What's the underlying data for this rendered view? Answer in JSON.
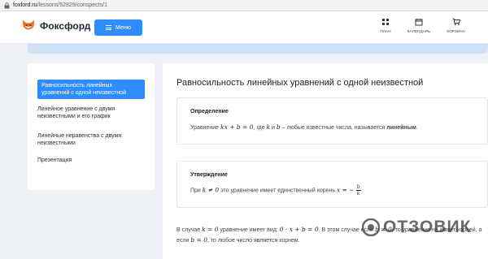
{
  "browser": {
    "url_domain": "foxford.ru",
    "url_path": "/lessons/52829/conspects/1"
  },
  "header": {
    "brand": "Фоксфорд",
    "menu_label": "Меню",
    "nav": [
      {
        "label": "ПЛАН",
        "icon": "plan-icon"
      },
      {
        "label": "КАЛЕНДАРЬ",
        "icon": "calendar-icon"
      },
      {
        "label": "КОРЗИНА",
        "icon": "cart-icon"
      }
    ]
  },
  "colors": {
    "accent": "#2f8cff",
    "banner": "#cfe1f7",
    "background": "#eef1f6"
  },
  "sidebar": {
    "items": [
      {
        "label": "Равносильность линейных уравнений с одной неизвестной",
        "active": true
      },
      {
        "label": "Линейное уравнение с двумя неизвестными и его график",
        "active": false
      },
      {
        "label": "Линейные неравенства с двумя неизвестными",
        "active": false
      },
      {
        "label": "Презентация",
        "active": false
      }
    ]
  },
  "main": {
    "title": "Равносильность линейных уравнений с одной неизвестной",
    "definition": {
      "title": "Определение",
      "text_prefix": "Уравнение",
      "formula": "kx + b = 0",
      "text_mid1": ", где",
      "var_k": "k",
      "text_and": "и",
      "var_b": "b",
      "text_mid2": "– любые известные числа, называется",
      "term": "линейным",
      "text_end": "."
    },
    "statement": {
      "title": "Утверждение",
      "text_prefix": "При",
      "condition": "k ≠ 0",
      "text_mid": "это уравнение имеет единственный корень",
      "root_lhs": "x = −",
      "root_num": "b",
      "root_den": "k"
    },
    "paragraph": {
      "s1": "В случае",
      "m1": "k = 0",
      "s2": "уравнение имеет вид:",
      "m2": "0 · x + b = 0",
      "s3": ". В этом случае если",
      "m3": "b ≠ 0",
      "s4": ", то уравнение не имеет корней, а если",
      "m4": "b = 0",
      "s5": ", то любое число является корнем."
    }
  },
  "watermark": {
    "text": "ОТЗОВИК"
  }
}
